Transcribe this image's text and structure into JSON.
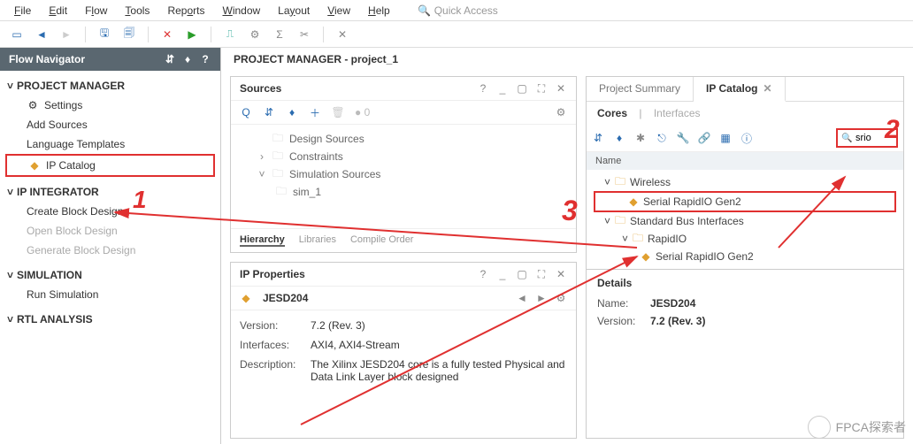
{
  "menu": [
    "File",
    "Edit",
    "Flow",
    "Tools",
    "Reports",
    "Window",
    "Layout",
    "View",
    "Help"
  ],
  "quick_access_placeholder": "Quick Access",
  "flow_nav": {
    "title": "Flow Navigator",
    "sections": [
      {
        "title": "PROJECT MANAGER",
        "items": [
          {
            "label": "Settings",
            "icon": "gear"
          },
          {
            "label": "Add Sources"
          },
          {
            "label": "Language Templates"
          },
          {
            "label": "IP Catalog",
            "icon": "ip",
            "boxed": true
          }
        ]
      },
      {
        "title": "IP INTEGRATOR",
        "items": [
          {
            "label": "Create Block Design"
          },
          {
            "label": "Open Block Design",
            "disabled": true
          },
          {
            "label": "Generate Block Design",
            "disabled": true
          }
        ]
      },
      {
        "title": "SIMULATION",
        "items": [
          {
            "label": "Run Simulation"
          }
        ]
      },
      {
        "title": "RTL ANALYSIS",
        "items": []
      }
    ]
  },
  "pm_title": "PROJECT MANAGER - project_1",
  "sources": {
    "title": "Sources",
    "count": "0",
    "tree": [
      {
        "label": "Design Sources",
        "level": 0
      },
      {
        "label": "Constraints",
        "level": 0,
        "chev": ">"
      },
      {
        "label": "Simulation Sources",
        "level": 0,
        "chev": "v"
      },
      {
        "label": "sim_1",
        "level": 1
      }
    ],
    "tabs": [
      "Hierarchy",
      "Libraries",
      "Compile Order"
    ]
  },
  "ip_props": {
    "title": "IP Properties",
    "name": "JESD204",
    "rows": [
      {
        "label": "Version:",
        "value": "7.2 (Rev. 3)"
      },
      {
        "label": "Interfaces:",
        "value": "AXI4, AXI4-Stream"
      },
      {
        "label": "Description:",
        "value": "The Xilinx JESD204 core is a fully tested Physical and Data Link Layer block designed"
      }
    ]
  },
  "catalog": {
    "tabs": [
      {
        "label": "Project Summary",
        "active": false
      },
      {
        "label": "IP Catalog",
        "active": true,
        "close": true
      }
    ],
    "subtabs": {
      "active": "Cores",
      "inactive": "Interfaces"
    },
    "search_value": "srio",
    "name_header": "Name",
    "tree": [
      {
        "label": "Wireless",
        "level": 0,
        "chev": "v"
      },
      {
        "label": "Serial RapidIO Gen2",
        "level": 1,
        "ip": true,
        "boxed": true
      },
      {
        "label": "Standard Bus Interfaces",
        "level": 0,
        "chev": "v"
      },
      {
        "label": "RapidIO",
        "level": 1,
        "chev": "v"
      },
      {
        "label": "Serial RapidIO Gen2",
        "level": 2,
        "ip": true
      }
    ],
    "details": {
      "title": "Details",
      "rows": [
        {
          "label": "Name:",
          "value": "JESD204"
        },
        {
          "label": "Version:",
          "value": "7.2 (Rev. 3)"
        }
      ]
    }
  },
  "annotations": {
    "one": "1",
    "two": "2",
    "three": "3"
  },
  "watermark": "FPCA探索者"
}
